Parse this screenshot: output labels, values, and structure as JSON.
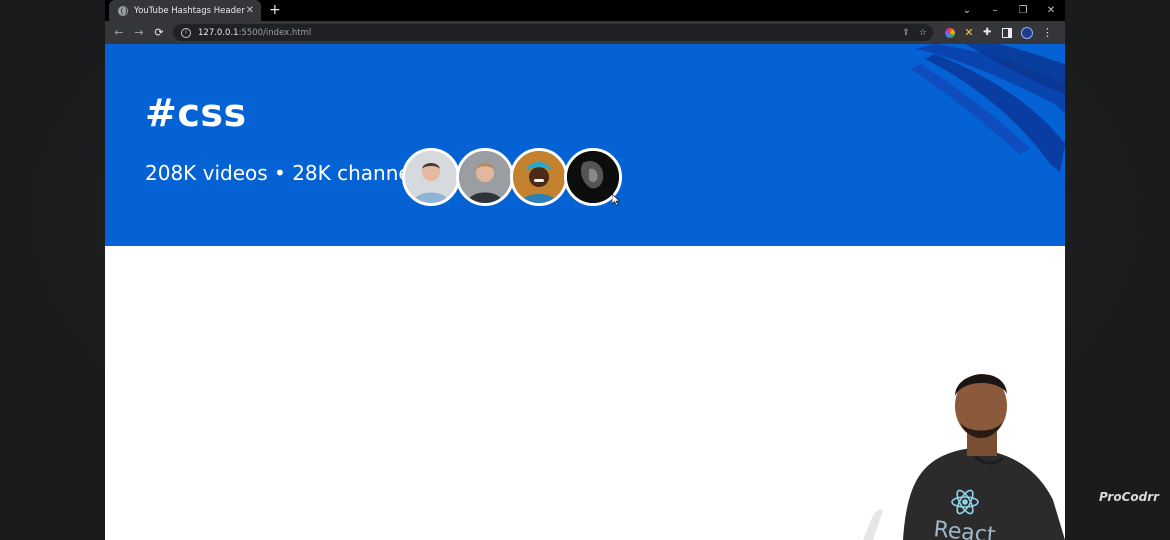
{
  "browser": {
    "tab_title": "YouTube Hashtags Header",
    "tab_close": "✕",
    "new_tab": "+",
    "url_host": "127.0.0.1",
    "url_path": ":5500/index.html",
    "window_controls": [
      "⌄",
      "–",
      "❐",
      "✕"
    ],
    "nav": {
      "back": "←",
      "forward": "→",
      "reload": "⟳"
    }
  },
  "page": {
    "hashtag": "#css",
    "stats": "208K videos • 28K channels",
    "avatars": [
      {
        "name": "avatar-1",
        "bg": "#c9cdd2"
      },
      {
        "name": "avatar-2",
        "bg": "#8d9196"
      },
      {
        "name": "avatar-3",
        "bg": "#c77a2e"
      },
      {
        "name": "avatar-4",
        "bg": "#111111"
      }
    ],
    "accent": "#0562d5"
  },
  "overlay": {
    "watermark": "ProCodrr",
    "shirt_text": "React"
  }
}
